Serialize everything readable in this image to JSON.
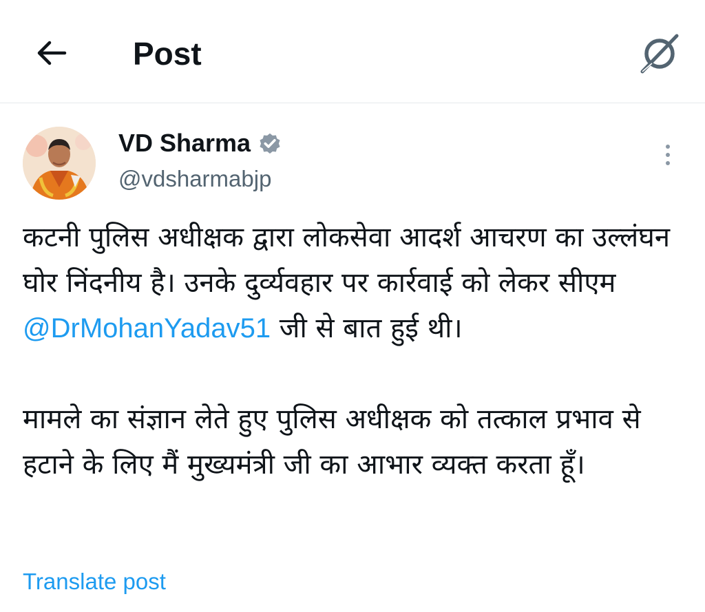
{
  "header": {
    "title": "Post",
    "back_icon": "arrow-left-icon",
    "grok_icon": "grok-icon"
  },
  "author": {
    "name": "VD Sharma",
    "handle": "@vdsharmabjp",
    "verified": true,
    "verified_color": "#8b98a5"
  },
  "post": {
    "p1_before": "कटनी पुलिस अधीक्षक द्वारा लोकसेवा आदर्श आचरण का उल्लंघन घोर निंदनीय है। उनके दुर्व्यवहार पर कार्रवाई को लेकर सीएम ",
    "p1_mention": "@DrMohanYadav51",
    "p1_after": " जी से बात हुई थी।",
    "p2": "मामले का संज्ञान लेते हुए पुलिस अधीक्षक को तत्काल प्रभाव से हटाने के लिए मैं मुख्यमंत्री जी का आभार व्यक्त करता हूँ।"
  },
  "translate_label": "Translate post",
  "colors": {
    "text": "#0f1419",
    "secondary": "#536471",
    "link": "#1d9bf0"
  }
}
